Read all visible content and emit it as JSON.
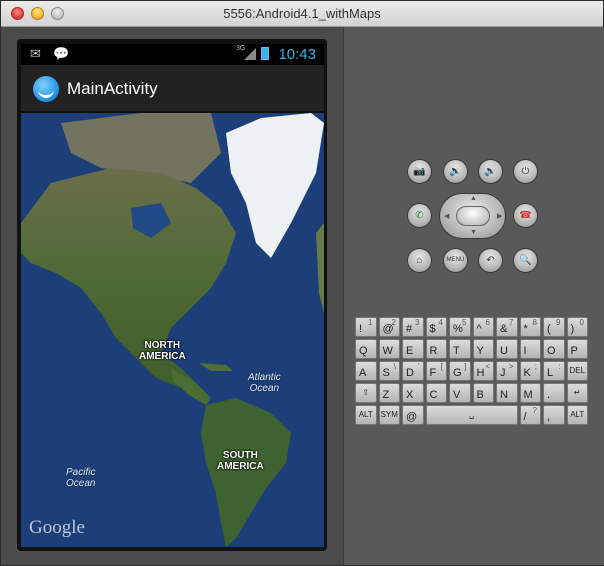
{
  "window": {
    "title": "5556:Android4.1_withMaps"
  },
  "status_bar": {
    "time": "10:43",
    "network": "3G",
    "icons": [
      "mail-icon",
      "chat-icon",
      "signal-icon",
      "battery-icon"
    ]
  },
  "action_bar": {
    "app_title": "MainActivity"
  },
  "map": {
    "labels": {
      "north_america": "NORTH\nAMERICA",
      "south_america": "SOUTH\nAMERICA"
    },
    "oceans": {
      "atlantic": "Atlantic\nOcean",
      "pacific": "Pacific\nOcean"
    },
    "attribution": "Google"
  },
  "controls": {
    "top_row": [
      "camera-icon",
      "volume-down-icon",
      "volume-up-icon",
      "power-icon"
    ],
    "call": "call-icon",
    "end_call": "end-call-icon",
    "bottom_row": [
      "home-icon",
      "menu-button",
      "back-icon",
      "search-icon"
    ],
    "menu_label": "MENU"
  },
  "keyboard": {
    "row1": [
      {
        "m": "Q",
        "a": "1"
      },
      {
        "m": "W",
        "a": "2"
      },
      {
        "m": "E",
        "a": "3"
      },
      {
        "m": "R",
        "a": "4"
      },
      {
        "m": "T",
        "a": "5"
      },
      {
        "m": "Y",
        "a": "6"
      },
      {
        "m": "U",
        "a": "7"
      },
      {
        "m": "I",
        "a": "8"
      },
      {
        "m": "O",
        "a": "9"
      },
      {
        "m": "P",
        "a": "0"
      }
    ],
    "row1_alt2": [
      "!",
      "@",
      "#",
      "$",
      "%",
      "^",
      "&",
      "*",
      "(",
      ")"
    ],
    "row2": [
      {
        "m": "A",
        "a": ""
      },
      {
        "m": "S",
        "a": "\\"
      },
      {
        "m": "D",
        "a": "'"
      },
      {
        "m": "F",
        "a": "["
      },
      {
        "m": "G",
        "a": "]"
      },
      {
        "m": "H",
        "a": "<"
      },
      {
        "m": "J",
        "a": ">"
      },
      {
        "m": "K",
        "a": ";"
      },
      {
        "m": "L",
        "a": ":"
      }
    ],
    "row2_alt": [
      "~",
      "`",
      "\"",
      "{",
      "}",
      "",
      "",
      "",
      ""
    ],
    "row3": [
      {
        "m": "Z",
        "a": ""
      },
      {
        "m": "X",
        "a": ""
      },
      {
        "m": "C",
        "a": ""
      },
      {
        "m": "V",
        "a": ""
      },
      {
        "m": "B",
        "a": ""
      },
      {
        "m": "N",
        "a": ""
      },
      {
        "m": "M",
        "a": ""
      },
      {
        "m": ".",
        "a": ""
      }
    ],
    "row1_extra": {
      "m": "-",
      "a": "+"
    },
    "row2_extra": {
      "m": "=",
      "a": "|"
    },
    "del": "DEL",
    "alt": "ALT",
    "sym": "SYM",
    "at": "@",
    "slash": "/",
    "question": "?",
    "comma": ","
  }
}
